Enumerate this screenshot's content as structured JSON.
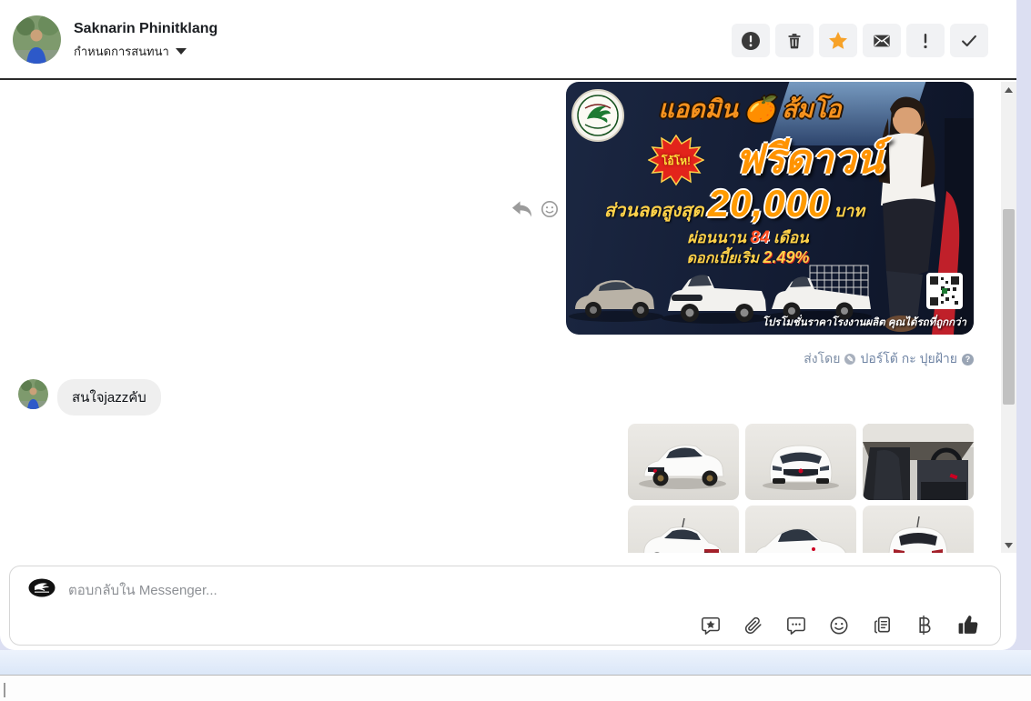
{
  "header": {
    "name": "Saknarin Phinitklang",
    "subtitle": "กำหนดการสนทนา",
    "action_icons": [
      "report-circle-icon",
      "trash-icon",
      "star-icon",
      "mail-icon",
      "exclamation-icon",
      "check-icon"
    ],
    "star_color": "#f7a228"
  },
  "conversation": {
    "ad": {
      "line1_prefix": "แอดมิน",
      "line1_emoji": "🍊",
      "line1_suffix": "ส้มโอ",
      "burst": "โอ้โห!",
      "headline": "ฟรีดาวน์",
      "discount_prefix": "ส่วนลดสูงสุด",
      "discount_amount": "20,000",
      "discount_suffix": "บาท",
      "installment_prefix": "ผ่อนนาน",
      "installment_number": "84",
      "installment_suffix": "เดือน",
      "interest_prefix": "ดอกเบี้ยเริ่ม",
      "interest_value": "2.49%",
      "caption": "โปรโมชั่นราคาโรงงานผลิต คุณได้รถที่ถูกกว่า"
    },
    "hover_icons": [
      "reply-icon",
      "emoji-react-icon"
    ],
    "sent_by": {
      "label": "ส่งโดย",
      "name": "ปอร์โต้ กะ ปุยฝ้าย",
      "help_glyph": "?"
    },
    "incoming_message": {
      "text": "สนใจjazzคับ"
    },
    "photo_grid": {
      "count": 6,
      "photos": [
        {
          "label": "car-front-quarter-view"
        },
        {
          "label": "car-front-view"
        },
        {
          "label": "car-interior-view"
        },
        {
          "label": "car-rear-quarter-view"
        },
        {
          "label": "car-side-view"
        },
        {
          "label": "car-rear-view"
        }
      ]
    }
  },
  "composer": {
    "placeholder": "ตอบกลับใน Messenger...",
    "tool_icons": [
      "saved-replies-icon",
      "attachment-icon",
      "comment-bubble-icon",
      "emoji-icon",
      "templates-icon",
      "baht-payment-icon",
      "like-thumb-icon"
    ]
  },
  "colors": {
    "page_background": "#dcdff2",
    "footer_band": "#dbe7f8",
    "accent_star": "#f7a228",
    "sent_by_text": "#7b8ca4",
    "bubble_background": "#efefef"
  }
}
